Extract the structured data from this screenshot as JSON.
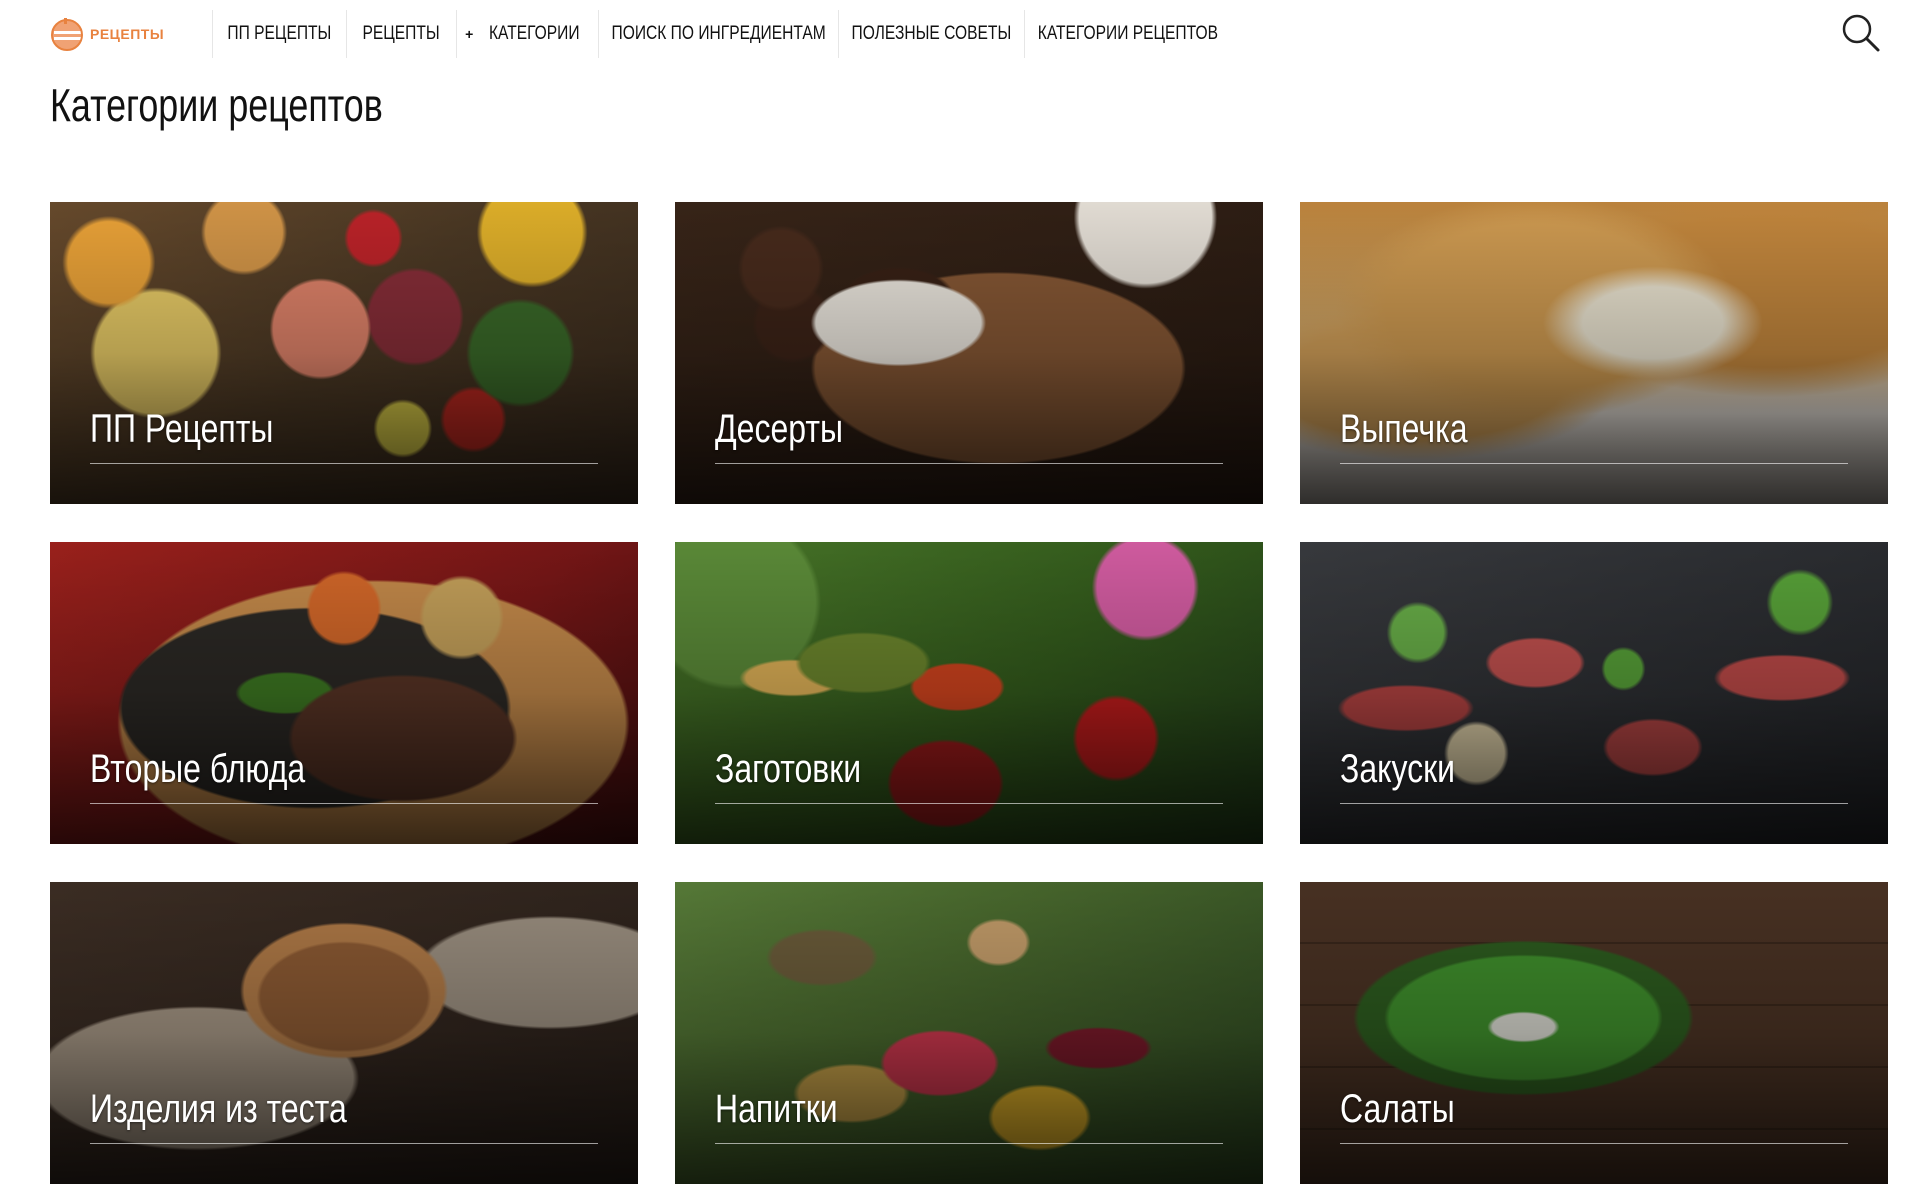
{
  "header": {
    "logo_text": "РЕЦЕПТЫ",
    "nav": [
      {
        "label": "ПП РЕЦЕПТЫ",
        "has_plus": false
      },
      {
        "label": "РЕЦЕПТЫ",
        "has_plus": false
      },
      {
        "label": "КАТЕГОРИИ",
        "has_plus": true
      },
      {
        "label": "ПОИСК ПО ИНГРЕДИЕНТАМ",
        "has_plus": false
      },
      {
        "label": "ПОЛЕЗНЫЕ СОВЕТЫ",
        "has_plus": false
      },
      {
        "label": "КАТЕГОРИИ РЕЦЕПТОВ",
        "has_plus": false
      }
    ],
    "search_icon": "search-icon"
  },
  "main": {
    "title": "Категории рецептов",
    "categories": [
      {
        "label": "ПП Рецепты",
        "image": "healthy-food-photo"
      },
      {
        "label": "Десерты",
        "image": "coffee-dessert-photo"
      },
      {
        "label": "Выпечка",
        "image": "pastry-pie-photo"
      },
      {
        "label": "Вторые блюда",
        "image": "steak-vegetables-photo"
      },
      {
        "label": "Заготовки",
        "image": "preserves-jars-photo"
      },
      {
        "label": "Закуски",
        "image": "canapes-photo"
      },
      {
        "label": "Изделия из теста",
        "image": "bread-loaf-photo"
      },
      {
        "label": "Напитки",
        "image": "drinks-bottles-photo"
      },
      {
        "label": "Салаты",
        "image": "salad-bowl-photo"
      }
    ]
  },
  "colors": {
    "logo_accent": "#e8823f",
    "nav_divider": "#e6e6e6",
    "text": "#111111"
  }
}
